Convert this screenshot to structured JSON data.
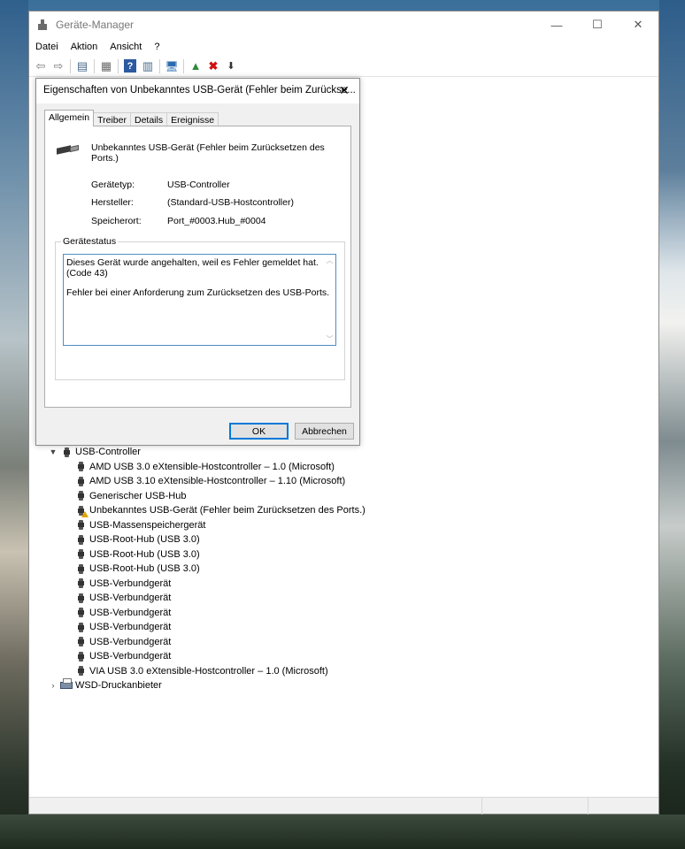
{
  "window": {
    "title": "Geräte-Manager",
    "controls": {
      "minimize": "—",
      "maximize": "☐",
      "close": "✕"
    }
  },
  "menu": [
    "Datei",
    "Aktion",
    "Ansicht",
    "?"
  ],
  "toolbar": {
    "back": "⇦",
    "forward": "⇨",
    "properties": "▤",
    "tree": "▦",
    "help": "?",
    "details": "▥",
    "scan": "🖥",
    "enable": "▲",
    "uninstall": "✖",
    "update": "⬇"
  },
  "tree": {
    "usb_controller": "USB-Controller",
    "usb_children": [
      "AMD USB 3.0 eXtensible-Hostcontroller – 1.0 (Microsoft)",
      "AMD USB 3.10 eXtensible-Hostcontroller – 1.10 (Microsoft)",
      "Generischer USB-Hub",
      "Unbekanntes USB-Gerät (Fehler beim Zurücksetzen des Ports.)",
      "USB-Massenspeichergerät",
      "USB-Root-Hub (USB 3.0)",
      "USB-Root-Hub (USB 3.0)",
      "USB-Root-Hub (USB 3.0)",
      "USB-Verbundgerät",
      "USB-Verbundgerät",
      "USB-Verbundgerät",
      "USB-Verbundgerät",
      "USB-Verbundgerät",
      "USB-Verbundgerät",
      "VIA USB 3.0 eXtensible-Hostcontroller – 1.0 (Microsoft)"
    ],
    "wsd": "WSD-Druckanbieter"
  },
  "dialog": {
    "title": "Eigenschaften von Unbekanntes USB-Gerät (Fehler beim Zurückse...",
    "close": "✕",
    "tabs": [
      "Allgemein",
      "Treiber",
      "Details",
      "Ereignisse"
    ],
    "device_name": "Unbekanntes USB-Gerät (Fehler beim Zurücksetzen des Ports.)",
    "props": {
      "type_label": "Gerätetyp:",
      "type_value": "USB-Controller",
      "maker_label": "Hersteller:",
      "maker_value": "(Standard-USB-Hostcontroller)",
      "location_label": "Speicherort:",
      "location_value": "Port_#0003.Hub_#0004"
    },
    "status_group": "Gerätestatus",
    "status_line1": "Dieses Gerät wurde angehalten, weil es Fehler gemeldet hat.",
    "status_line2": "(Code 43)",
    "status_line3": "Fehler bei einer Anforderung zum Zurücksetzen des USB-Ports.",
    "ok": "OK",
    "cancel": "Abbrechen"
  }
}
